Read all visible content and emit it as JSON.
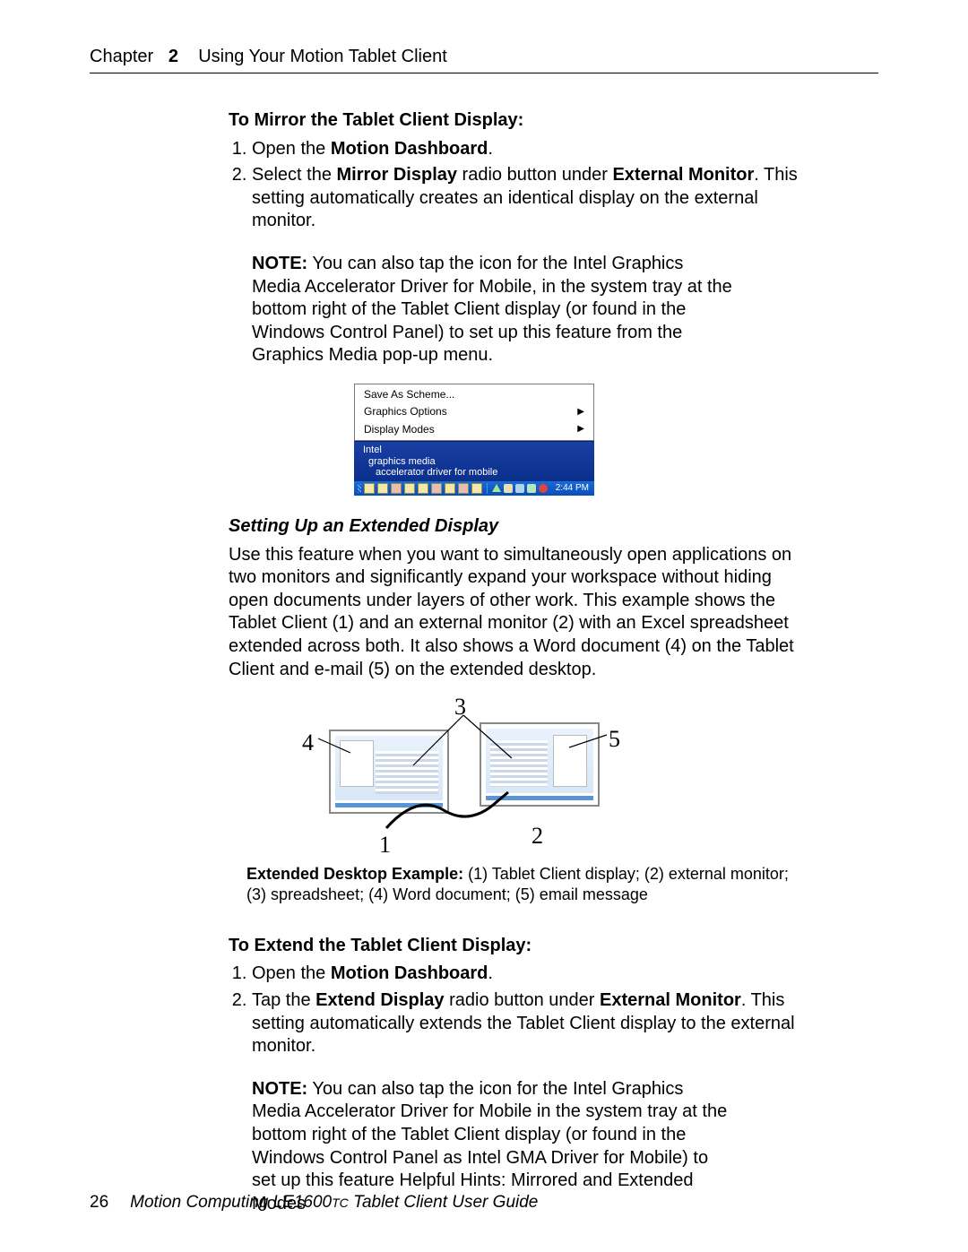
{
  "header": {
    "chapter_label": "Chapter",
    "chapter_number": "2",
    "chapter_title": "Using Your Motion Tablet Client"
  },
  "section_mirror": {
    "heading": "To Mirror the Tablet Client Display:",
    "step1_pre": "Open the ",
    "step1_bold": "Motion Dashboard",
    "step1_post": ".",
    "step2_pre": "Select the ",
    "step2_b1": "Mirror Display",
    "step2_mid": " radio button under ",
    "step2_b2": "External Monitor",
    "step2_post": ". This setting automatically creates an identical display on the external monitor.",
    "note_label": "NOTE:",
    "note_text": " You can also tap the icon for the Intel Graphics Media Accelerator Driver for Mobile, in the system tray at the bottom right of the Tablet Client display (or found in the Windows Control Panel) to set up this feature from the Graphics Media pop-up menu."
  },
  "popup": {
    "item1": "Save As Scheme...",
    "item2": "Graphics Options",
    "item3": "Display Modes",
    "banner_l1": "Intel",
    "banner_l2": "graphics media",
    "banner_l3": "accelerator driver for mobile",
    "clock": "2:44 PM"
  },
  "section_ext_setup": {
    "heading": "Setting Up an Extended Display",
    "body": "Use this feature when you want to simultaneously open applications on two monitors and significantly expand your workspace without hiding open documents under layers of other work. This example shows the Tablet Client (1) and an external monitor (2) with an Excel spreadsheet extended across both. It also shows a Word document (4) on the Tablet Client and e-mail (5) on the extended desktop."
  },
  "ext_figure": {
    "n1": "1",
    "n2": "2",
    "n3": "3",
    "n4": "4",
    "n5": "5",
    "caption_bold": "Extended Desktop Example:",
    "caption_text": " (1) Tablet Client display; (2) external monitor; (3) spreadsheet; (4) Word document; (5) email message"
  },
  "section_extend": {
    "heading": "To Extend the Tablet Client Display:",
    "step1_pre": "Open the ",
    "step1_bold": "Motion Dashboard",
    "step1_post": ".",
    "step2_pre": "Tap the ",
    "step2_b1": "Extend Display",
    "step2_mid": " radio button under ",
    "step2_b2": "External Monitor",
    "step2_post": ". This setting automatically extends the Tablet Client display to the external monitor.",
    "note_label": "NOTE:",
    "note_text": " You can also tap the icon for the Intel Graphics Media Accelerator Driver for Mobile in the system tray at the bottom right of the Tablet Client display (or found in the Windows Control Panel as Intel GMA Driver for Mobile) to set up this feature Helpful Hints: Mirrored and Extended Modes"
  },
  "footer": {
    "page_number": "26",
    "title_pre": "Motion Computing LE1600",
    "title_tc": "TC",
    "title_post": " Tablet Client User Guide"
  }
}
